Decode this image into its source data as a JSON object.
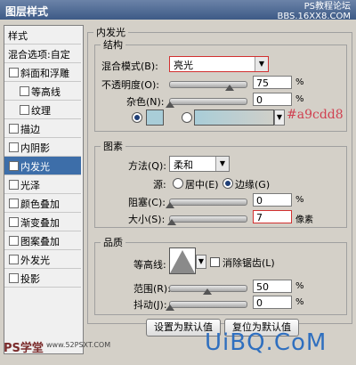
{
  "window": {
    "title": "图层样式",
    "watermark_top": "PS教程论坛\nBBS.16XX8.COM"
  },
  "left_panel": {
    "items": [
      {
        "label": "样式",
        "type": "header",
        "checked": false
      },
      {
        "label": "混合选项:自定",
        "type": "header",
        "checked": false
      },
      {
        "label": "斜面和浮雕",
        "type": "item",
        "checked": false
      },
      {
        "label": "等高线",
        "type": "sub",
        "checked": false
      },
      {
        "label": "纹理",
        "type": "sub",
        "checked": false
      },
      {
        "label": "描边",
        "type": "item",
        "checked": false
      },
      {
        "label": "内阴影",
        "type": "item",
        "checked": false
      },
      {
        "label": "内发光",
        "type": "item",
        "checked": true,
        "selected": true
      },
      {
        "label": "光泽",
        "type": "item",
        "checked": false
      },
      {
        "label": "颜色叠加",
        "type": "item",
        "checked": false
      },
      {
        "label": "渐变叠加",
        "type": "item",
        "checked": false
      },
      {
        "label": "图案叠加",
        "type": "item",
        "checked": false
      },
      {
        "label": "外发光",
        "type": "item",
        "checked": false
      },
      {
        "label": "投影",
        "type": "item",
        "checked": false
      }
    ]
  },
  "inner_glow": {
    "title": "内发光",
    "structure": {
      "title": "结构",
      "blend_mode_label": "混合模式(B):",
      "blend_mode_value": "亮光",
      "opacity_label": "不透明度(O):",
      "opacity_value": "75",
      "noise_label": "杂色(N):",
      "noise_value": "0",
      "percent": "%",
      "color_hex": "#a9cdd8",
      "color_swatch": "#a9cdd8",
      "opacity_fraction": 0.75,
      "noise_fraction": 0.0
    },
    "elements": {
      "title": "图素",
      "method_label": "方法(Q):",
      "method_value": "柔和",
      "source_label": "源:",
      "source_center": "居中(E)",
      "source_edge": "边缘(G)",
      "choke_label": "阻塞(C):",
      "choke_value": "0",
      "size_label": "大小(S):",
      "size_value": "7",
      "px_unit": "像素",
      "percent": "%",
      "choke_fraction": 0.0,
      "size_fraction": 0.03
    },
    "quality": {
      "title": "品质",
      "contour_label": "等高线:",
      "antialias_label": "消除锯齿(L)",
      "range_label": "范围(R):",
      "range_value": "50",
      "jitter_label": "抖动(J):",
      "jitter_value": "0",
      "percent": "%",
      "range_fraction": 0.5,
      "jitter_fraction": 0.0
    },
    "buttons": {
      "set_default": "设置为默认值",
      "reset_default": "复位为默认值"
    }
  },
  "watermarks": {
    "bottom_left": "PS学堂",
    "bottom_left_url": "www.52PSXT.COM",
    "bottom_right": "UiBQ.CoM"
  }
}
